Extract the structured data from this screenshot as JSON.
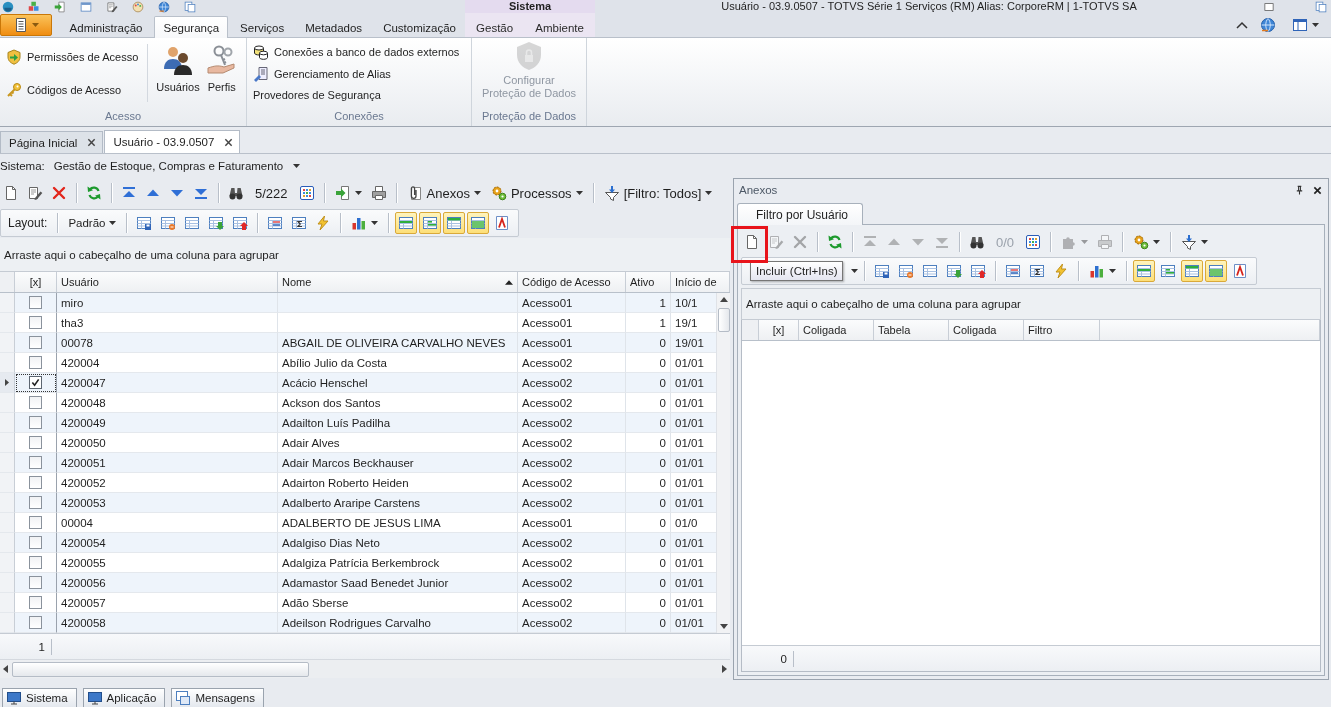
{
  "title_bar": {
    "context_group": "Sistema",
    "title": "Usuário - 03.9.0507 - TOTVS Série 1 Serviços (RM) Alias: CorporeRM | 1-TOTVS SA"
  },
  "ribbon": {
    "tabs": [
      {
        "label": "Administração",
        "selected": false,
        "contextual": false
      },
      {
        "label": "Segurança",
        "selected": true,
        "contextual": false
      },
      {
        "label": "Serviços",
        "selected": false,
        "contextual": false
      },
      {
        "label": "Metadados",
        "selected": false,
        "contextual": false
      },
      {
        "label": "Customização",
        "selected": false,
        "contextual": false
      },
      {
        "label": "Gestão",
        "selected": false,
        "contextual": true
      },
      {
        "label": "Ambiente",
        "selected": false,
        "contextual": true
      }
    ],
    "groups": [
      {
        "label": "Acesso",
        "items": [
          {
            "kind": "small",
            "label": "Permissões de Acesso",
            "disabled": false
          },
          {
            "kind": "small",
            "label": "Códigos de Acesso",
            "disabled": false
          },
          {
            "kind": "large",
            "label": "Usuários",
            "disabled": false
          },
          {
            "kind": "large",
            "label": "Perfis",
            "disabled": false
          }
        ]
      },
      {
        "label": "Conexões",
        "items": [
          {
            "kind": "small",
            "label": "Conexões a banco de dados externos",
            "disabled": false
          },
          {
            "kind": "small",
            "label": "Gerenciamento de Alias",
            "disabled": false
          },
          {
            "kind": "plain",
            "label": "Provedores de Segurança",
            "disabled": false
          }
        ]
      },
      {
        "label": "Proteção de Dados",
        "items": [
          {
            "kind": "large",
            "label": "Configurar\nProteção de Dados",
            "disabled": true
          }
        ]
      }
    ]
  },
  "document_tabs": [
    {
      "label": "Página Inicial",
      "selected": false
    },
    {
      "label": "Usuário - 03.9.0507",
      "selected": true
    }
  ],
  "system_selector": {
    "label": "Sistema:",
    "value": "Gestão de Estoque, Compras e Faturamento"
  },
  "toolbar": {
    "counter": "5/222",
    "attachments": "Anexos",
    "processes": "Processos",
    "filter": "[Filtro: Todos]"
  },
  "layout_bar": {
    "label": "Layout:",
    "layout": "Padrão",
    "toggles": [
      {
        "on": true
      },
      {
        "on": true
      },
      {
        "on": true
      },
      {
        "on": true
      }
    ]
  },
  "grid": {
    "group_hint": "Arraste aqui o cabeçalho de uma coluna para agrupar",
    "columns": [
      {
        "label": "[x]",
        "sorted": false
      },
      {
        "label": "Usuário",
        "sorted": false
      },
      {
        "label": "Nome",
        "sorted": true
      },
      {
        "label": "Código de Acesso",
        "sorted": false
      },
      {
        "label": "Ativo",
        "sorted": false
      },
      {
        "label": "Início de",
        "sorted": false
      }
    ],
    "rows": [
      {
        "user": "miro",
        "access_code": "Acesso01",
        "active": "1",
        "start": "10/1",
        "checked": false,
        "selected": false
      },
      {
        "user": "tha3",
        "access_code": "Acesso01",
        "active": "1",
        "start": "19/1",
        "checked": false,
        "selected": false
      },
      {
        "user": "00078",
        "name": "ABGAIL DE OLIVEIRA CARVALHO NEVES",
        "access_code": "Acesso01",
        "active": "0",
        "start": "19/01",
        "checked": false,
        "selected": false
      },
      {
        "user": "420004",
        "name": "Abílio Julio da Costa",
        "access_code": "Acesso02",
        "active": "0",
        "start": "01/01",
        "checked": false,
        "selected": false
      },
      {
        "user": "4200047",
        "name": "Acácio Henschel",
        "access_code": "Acesso02",
        "active": "0",
        "start": "01/01",
        "checked": true,
        "selected": true
      },
      {
        "user": "4200048",
        "name": "Ackson dos Santos",
        "access_code": "Acesso02",
        "active": "0",
        "start": "01/01",
        "checked": false,
        "selected": false
      },
      {
        "user": "4200049",
        "name": "Adailton Luís Padilha",
        "access_code": "Acesso02",
        "active": "0",
        "start": "01/01",
        "checked": false,
        "selected": false
      },
      {
        "user": "4200050",
        "name": "Adair Alves",
        "access_code": "Acesso02",
        "active": "0",
        "start": "01/01",
        "checked": false,
        "selected": false
      },
      {
        "user": "4200051",
        "name": "Adair Marcos Beckhauser",
        "access_code": "Acesso02",
        "active": "0",
        "start": "01/01",
        "checked": false,
        "selected": false
      },
      {
        "user": "4200052",
        "name": "Adairton Roberto Heiden",
        "access_code": "Acesso02",
        "active": "0",
        "start": "01/01",
        "checked": false,
        "selected": false
      },
      {
        "user": "4200053",
        "name": "Adalberto Araripe Carstens",
        "access_code": "Acesso02",
        "active": "0",
        "start": "01/01",
        "checked": false,
        "selected": false
      },
      {
        "user": "00004",
        "name": "ADALBERTO DE JESUS LIMA",
        "access_code": "Acesso01",
        "active": "0",
        "start": "01/0",
        "checked": false,
        "selected": false
      },
      {
        "user": "4200054",
        "name": "Adalgiso Dias Neto",
        "access_code": "Acesso02",
        "active": "0",
        "start": "01/01",
        "checked": false,
        "selected": false
      },
      {
        "user": "4200055",
        "name": "Adalgiza Patrícia Berkembrock",
        "access_code": "Acesso02",
        "active": "0",
        "start": "01/01",
        "checked": false,
        "selected": false
      },
      {
        "user": "4200056",
        "name": "Adamastor Saad Benedet Junior",
        "access_code": "Acesso02",
        "active": "0",
        "start": "01/01",
        "checked": false,
        "selected": false
      },
      {
        "user": "4200057",
        "name": "Adão Sberse",
        "access_code": "Acesso02",
        "active": "0",
        "start": "01/01",
        "checked": false,
        "selected": false
      },
      {
        "user": "4200058",
        "name": "Adeilson Rodrigues Carvalho",
        "access_code": "Acesso02",
        "active": "0",
        "start": "01/01",
        "checked": false,
        "selected": false
      }
    ],
    "summary": "1"
  },
  "anexos_panel": {
    "title": "Anexos",
    "tabs": [
      {
        "label": "Filtro por Usuário",
        "selected": true
      }
    ],
    "toolbar": {
      "buttons": [
        {
          "disabled": false,
          "marked": true
        },
        {
          "disabled": true,
          "marked": false
        },
        {
          "disabled": true,
          "marked": false
        },
        {
          "disabled": false,
          "marked": false
        },
        {
          "disabled": true,
          "marked": false
        },
        {
          "disabled": true,
          "marked": false
        },
        {
          "disabled": true,
          "marked": false
        },
        {
          "disabled": true,
          "marked": false
        },
        {
          "disabled": false,
          "marked": false
        },
        {
          "disabled": false,
          "marked": false
        },
        {
          "disabled": true,
          "marked": false
        },
        {
          "disabled": true,
          "marked": false
        },
        {
          "disabled": false,
          "marked": false
        },
        {
          "disabled": false,
          "marked": false
        }
      ],
      "counter": {
        "text": "0/0",
        "disabled": true
      }
    },
    "tooltip": "Incluir (Ctrl+Ins)",
    "layout_toggles": [
      {
        "on": true
      },
      {
        "on": false
      },
      {
        "on": true
      },
      {
        "on": true
      }
    ],
    "group_hint": "Arraste aqui o cabeçalho de uma coluna para agrupar",
    "columns": [
      "[x]",
      "Coligada",
      "Tabela",
      "Coligada",
      "Filtro"
    ],
    "summary": "0"
  },
  "bottom_tabs": [
    "Sistema",
    "Aplicação",
    "Mensagens"
  ]
}
